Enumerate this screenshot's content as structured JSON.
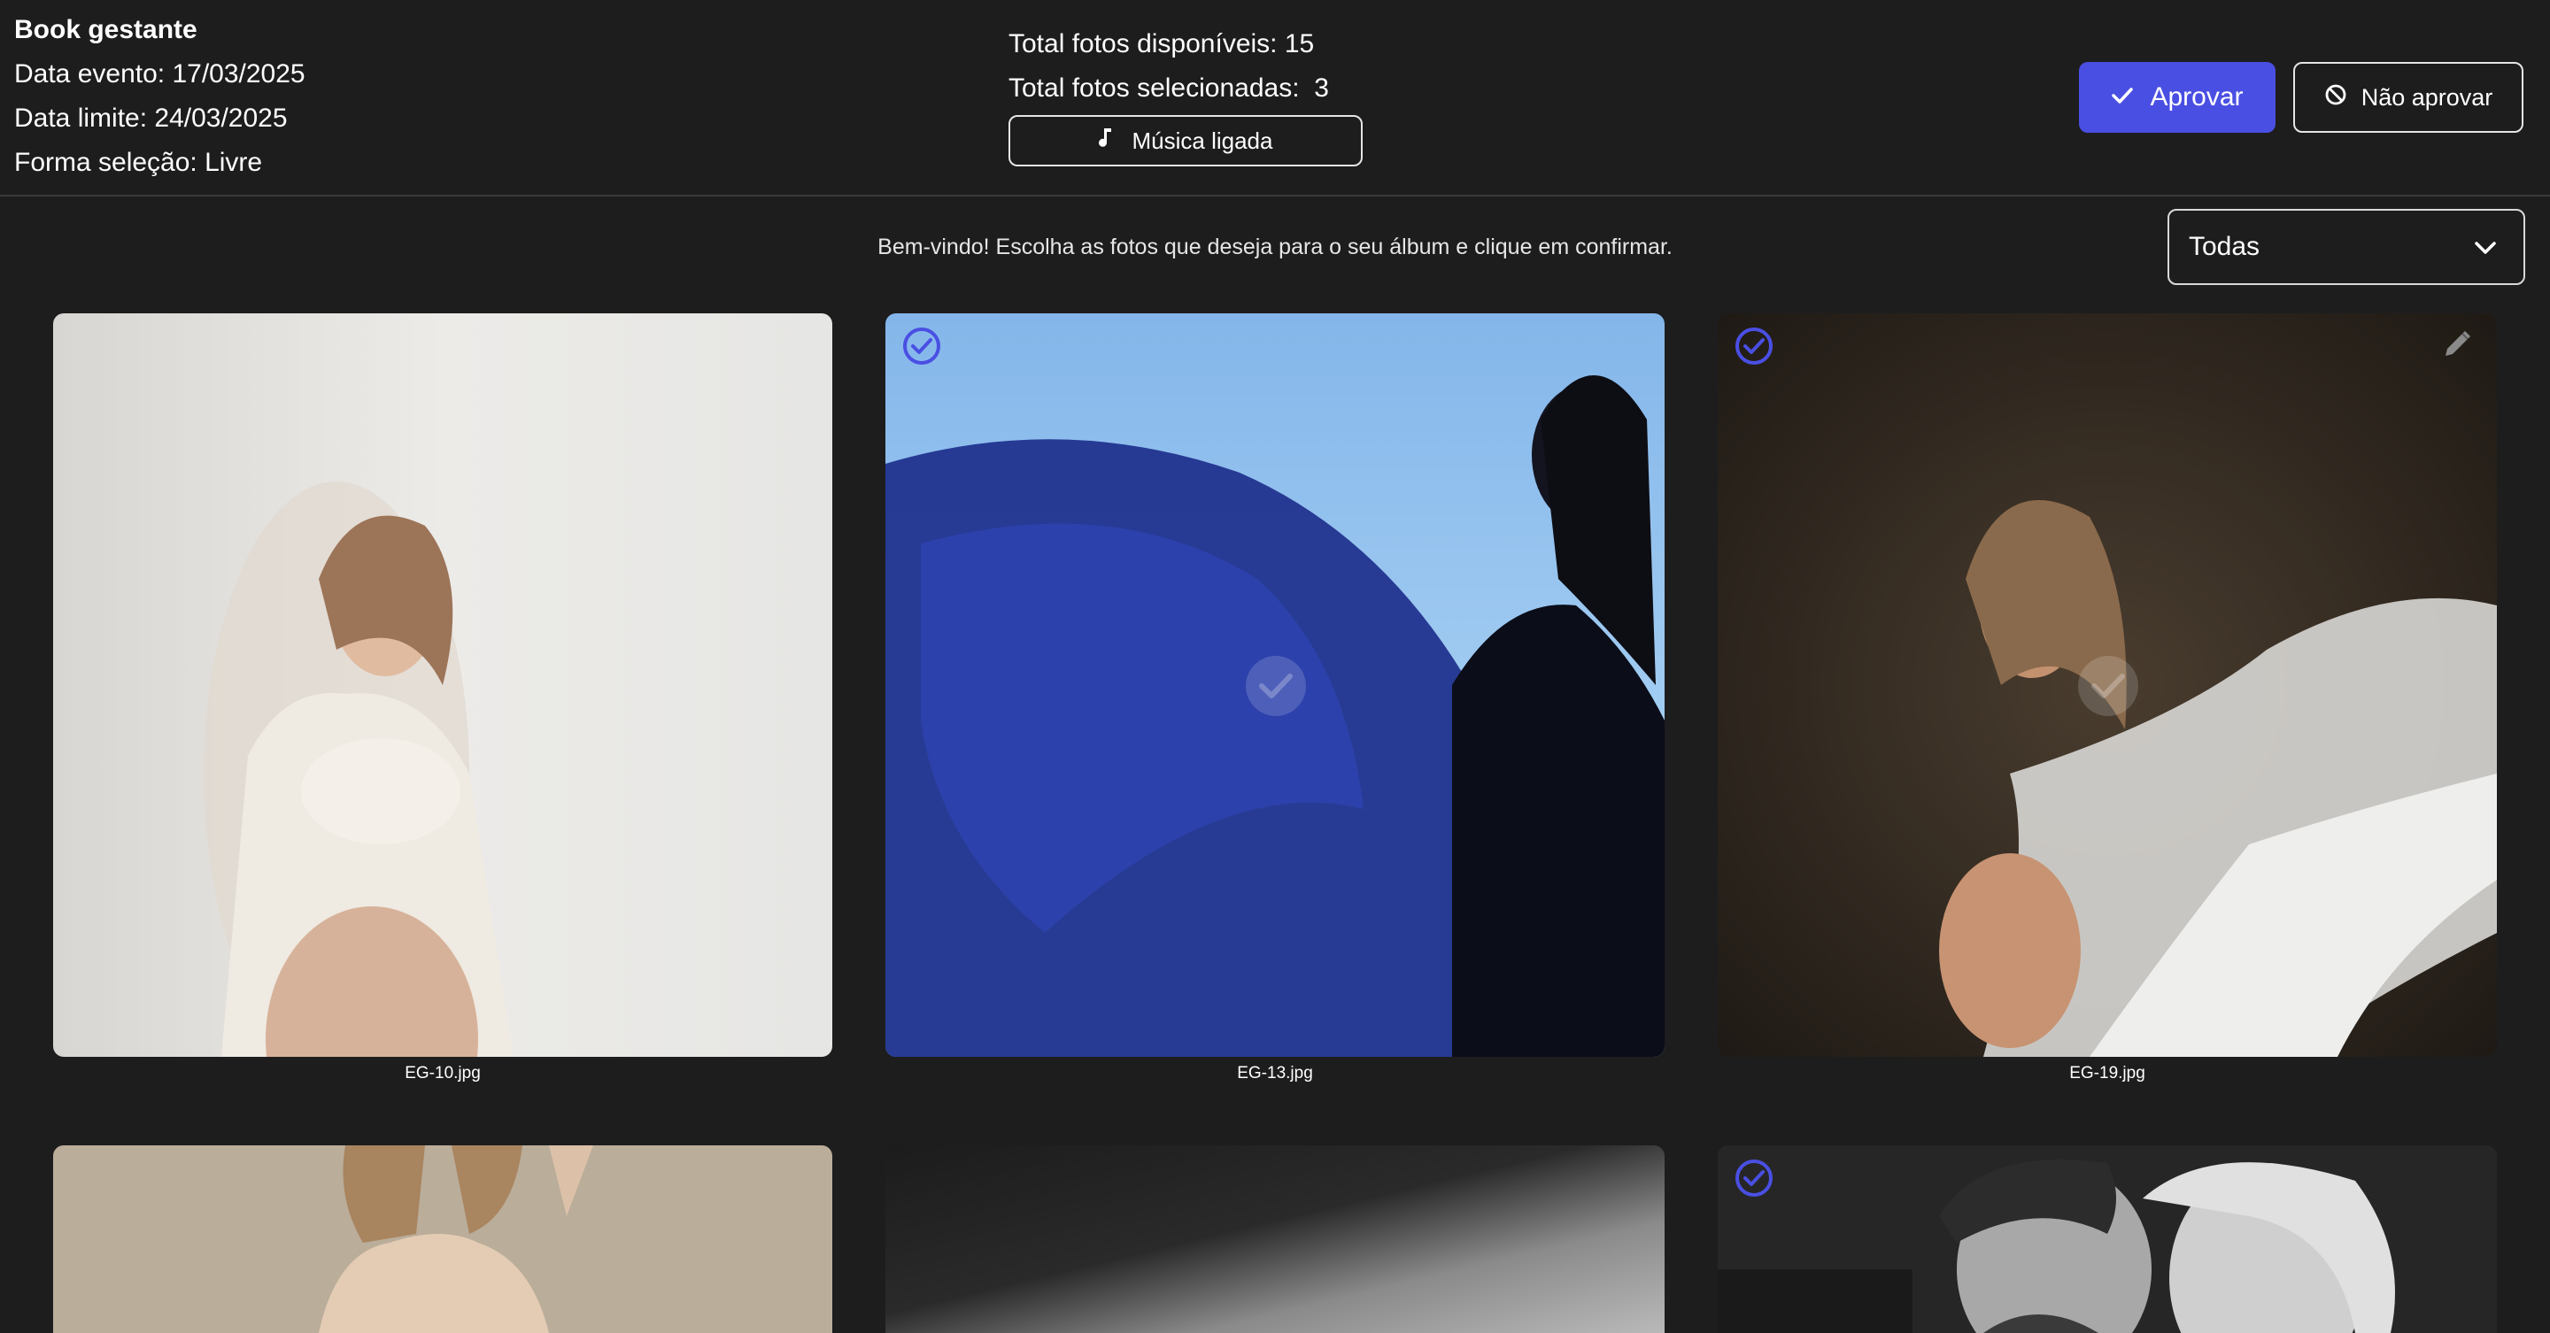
{
  "header": {
    "album_title": "Book gestante",
    "event_date": "Data evento: 17/03/2025",
    "deadline": "Data limite: 24/03/2025",
    "selection_mode": "Forma seleção: Livre",
    "total_available": "Total fotos disponíveis: 15",
    "total_selected": "Total fotos selecionadas:  3",
    "music_label": "Música ligada",
    "approve_label": "Aprovar",
    "reject_label": "Não aprovar"
  },
  "welcome_text": "Bem-vindo! Escolha as fotos que deseja para o seu álbum e clique em confirmar.",
  "filter": {
    "selected": "Todas"
  },
  "photos": [
    {
      "filename": "EG-10.jpg",
      "selected": false
    },
    {
      "filename": "EG-13.jpg",
      "selected": true
    },
    {
      "filename": "EG-19.jpg",
      "selected": true
    },
    {
      "filename": "",
      "selected": false
    },
    {
      "filename": "",
      "selected": false
    },
    {
      "filename": "",
      "selected": true
    }
  ],
  "colors": {
    "background": "#1d1d1e",
    "accent": "#4a4fe3",
    "text": "#ffffff"
  },
  "icons": [
    "check-icon",
    "ban-icon",
    "music-note-icon",
    "chevron-down-icon",
    "check-circle-icon",
    "pencil-icon"
  ]
}
